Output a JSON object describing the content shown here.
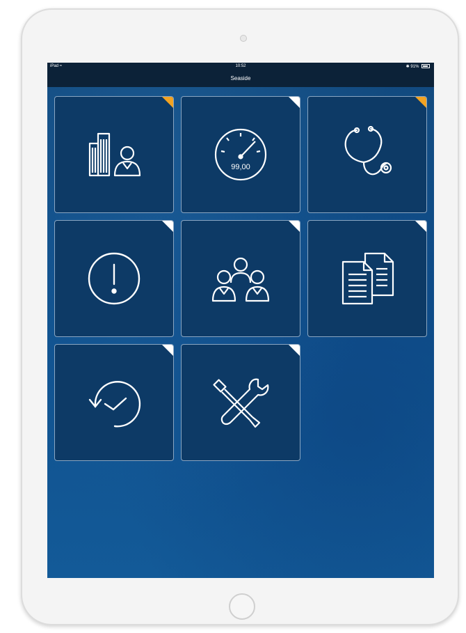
{
  "status_bar": {
    "device": "iPad",
    "time": "10:52",
    "battery": "91%"
  },
  "nav": {
    "title": "Seaside"
  },
  "tiles": [
    {
      "icon": "building-person-icon",
      "corner": "orange"
    },
    {
      "icon": "speedometer-icon",
      "corner": "white",
      "readout": "99,00"
    },
    {
      "icon": "stethoscope-icon",
      "corner": "orange"
    },
    {
      "icon": "alert-icon",
      "corner": "white"
    },
    {
      "icon": "team-icon",
      "corner": "white"
    },
    {
      "icon": "documents-icon",
      "corner": "white"
    },
    {
      "icon": "history-clock-icon",
      "corner": "white"
    },
    {
      "icon": "tools-icon",
      "corner": "white"
    }
  ],
  "colors": {
    "tile_bg": "#0d3a66",
    "accent_orange": "#f2a322",
    "bar_bg": "#0c2238"
  }
}
